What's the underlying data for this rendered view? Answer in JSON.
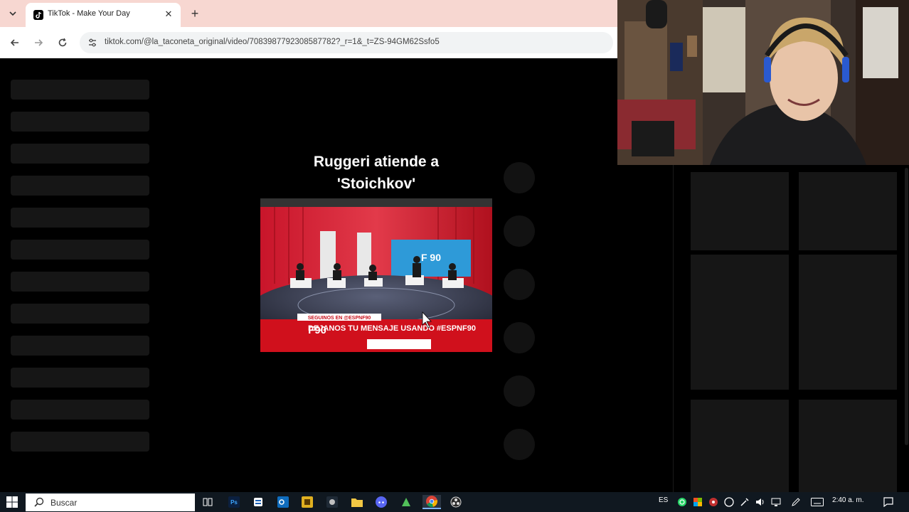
{
  "browser": {
    "tab_title": "TikTok - Make Your Day",
    "url": "tiktok.com/@la_taconeta_original/video/7083987792308587782?_r=1&_t=ZS-94GM62Ssfo5",
    "icons": {
      "tab_list": "chevron-down-icon",
      "favicon": "tiktok-icon",
      "close": "close-icon",
      "new_tab": "plus-icon",
      "back": "arrow-left-icon",
      "forward": "arrow-right-icon",
      "reload": "reload-icon",
      "site_info": "tune-icon"
    }
  },
  "video": {
    "title_line1": "Ruggeri atiende a",
    "title_line2": "'Stoichkov'",
    "overlay_banner": "DEJANOS TU MENSAJE USANDO #ESPNF90",
    "overlay_small": "SEGUINOS EN @ESPNF90",
    "set_logo": "F90"
  },
  "taskbar": {
    "search_placeholder": "Buscar",
    "language": "ES",
    "clock": "2:40 a. m.",
    "apps": [
      "task-view-icon",
      "photoshop-icon",
      "app-icon",
      "outlook-icon",
      "app-icon",
      "file-explorer-icon",
      "discord-icon",
      "app-icon",
      "chrome-icon",
      "obs-icon"
    ]
  },
  "colors": {
    "tabstrip": "#f7d7d1",
    "background": "#000000",
    "skeleton": "#161616",
    "taskbar": "#101820"
  }
}
